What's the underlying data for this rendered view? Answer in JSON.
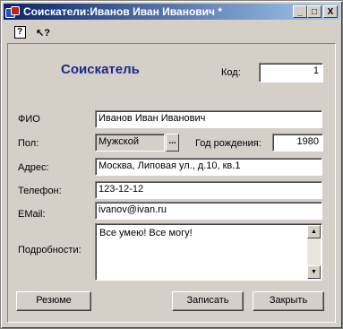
{
  "window": {
    "title": "Соискатели:Иванов Иван Иванович *",
    "minimize": "_",
    "maximize": "□",
    "close": "X"
  },
  "toolbar": {
    "help_glyph": "?",
    "context_help_glyph": "↖?"
  },
  "form": {
    "heading": "Соискатель",
    "code_label": "Код:",
    "code_value": "1",
    "fio_label": "ФИО",
    "fio_value": "Иванов Иван Иванович",
    "gender_label": "Пол:",
    "gender_value": "Мужской",
    "gender_button": "...",
    "birth_year_label": "Год рождения:",
    "birth_year_value": "1980",
    "address_label": "Адрес:",
    "address_value": "Москва, Липовая ул., д.10, кв.1",
    "phone_label": "Телефон:",
    "phone_value": "123-12-12",
    "email_label": "EMail:",
    "email_value": "ivanov@ivan.ru",
    "details_label": "Подробности:",
    "details_value": "Все умею! Все могу!"
  },
  "buttons": {
    "resume": "Резюме",
    "save": "Записать",
    "close": "Закрыть"
  },
  "colors": {
    "titlebar_start": "#0a246a",
    "titlebar_end": "#a6caf0",
    "heading": "#1c2a8c",
    "window_bg": "#d4d0c8"
  }
}
